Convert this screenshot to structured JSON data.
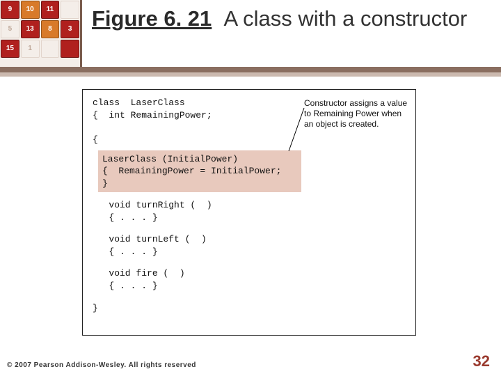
{
  "decor": {
    "rows": [
      [
        {
          "t": "9",
          "c": "red"
        },
        {
          "t": "10",
          "c": "orange"
        },
        {
          "t": "11",
          "c": "red"
        },
        {
          "t": "",
          "c": "beige"
        }
      ],
      [
        {
          "t": "5",
          "c": "beige"
        },
        {
          "t": "13",
          "c": "red"
        },
        {
          "t": "8",
          "c": "orange"
        },
        {
          "t": "3",
          "c": "red"
        }
      ],
      [
        {
          "t": "15",
          "c": "red"
        },
        {
          "t": "1",
          "c": "beige"
        },
        {
          "t": "",
          "c": "beige"
        },
        {
          "t": "",
          "c": "red"
        }
      ]
    ]
  },
  "title": {
    "figure_label": "Figure 6. 21",
    "caption": "A class with a constructor"
  },
  "code": {
    "line1": "class  LaserClass",
    "line2": "{  int RemainingPower;",
    "hl1": "LaserClass (InitialPower)",
    "hl2": "{  RemainingPower = InitialPower;",
    "hl3": "}",
    "m1": "   void turnRight (  )",
    "m1b": "   { . . . }",
    "m2": "   void turnLeft (  )",
    "m2b": "   { . . . }",
    "m3": "   void fire (  )",
    "m3b": "   { . . . }",
    "end": "}"
  },
  "annotation": "Constructor assigns a value to Remaining Power when an object is created.",
  "footer": "© 2007 Pearson Addison-Wesley. All rights reserved",
  "page": "32"
}
